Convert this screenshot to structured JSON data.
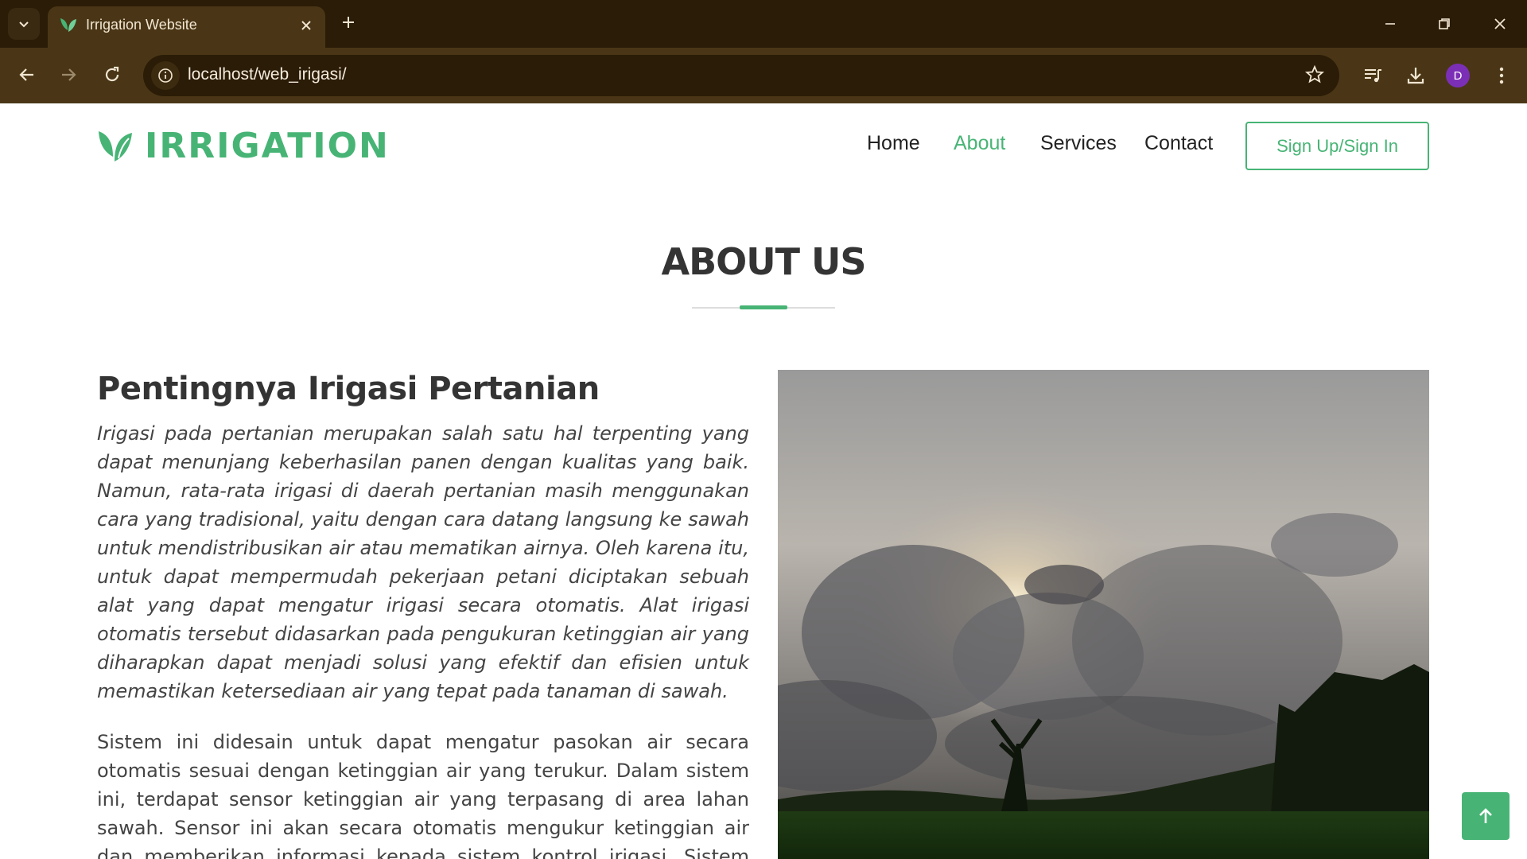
{
  "browser": {
    "tab_title": "Irrigation Website",
    "url": "localhost/web_irigasi/",
    "profile_initial": "D"
  },
  "site": {
    "logo_text": "IRRIGATION",
    "brand_color": "#47b475",
    "nav": [
      {
        "label": "Home",
        "active": false
      },
      {
        "label": "About",
        "active": true
      },
      {
        "label": "Services",
        "active": false
      },
      {
        "label": "Contact",
        "active": false
      }
    ],
    "signin_label": "Sign Up/Sign In"
  },
  "about": {
    "section_title": "ABOUT US",
    "subtitle": "Pentingnya Irigasi Pertanian",
    "intro": "Irigasi pada pertanian merupakan salah satu hal terpenting yang dapat menunjang keberhasilan panen dengan kualitas yang baik. Namun, rata-rata irigasi di daerah pertanian masih menggunakan cara yang tradisional, yaitu dengan cara datang langsung ke sawah untuk mendistribusikan air atau mematikan airnya. Oleh karena itu, untuk dapat mempermudah pekerjaan petani diciptakan sebuah alat yang dapat mengatur irigasi secara otomatis. Alat irigasi otomatis tersebut didasarkan pada pengukuran ketinggian air yang diharapkan dapat menjadi solusi yang efektif dan efisien untuk memastikan ketersediaan air yang tepat pada tanaman di sawah.",
    "body": "Sistem ini didesain untuk dapat mengatur pasokan air secara otomatis sesuai dengan ketinggian air yang terukur. Dalam sistem ini, terdapat sensor ketinggian air yang terpasang di area lahan sawah. Sensor ini akan secara otomatis mengukur ketinggian air dan memberikan informasi kepada sistem kontrol irigasi. Sistem kontrol irigasi kemudian"
  }
}
